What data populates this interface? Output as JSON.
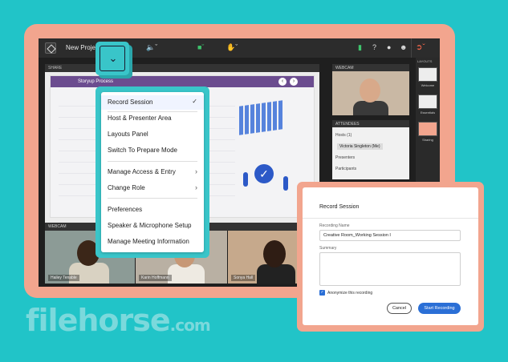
{
  "app": {
    "project_title": "New Project",
    "colors": {
      "accent": "#39c5c9",
      "frame": "#f2a58e",
      "primary_button": "#2b6fd6",
      "exit": "#f0664a"
    }
  },
  "topbar": {
    "icons": [
      "room-logo-icon",
      "speaker-icon",
      "video-camera-icon",
      "raise-hand-icon",
      "signal-icon",
      "help-icon",
      "bell-icon",
      "people-icon",
      "exit-icon"
    ]
  },
  "share_pod": {
    "header": "SHARE",
    "slide_title": "Storyup Process"
  },
  "webcam_bottom": {
    "header": "WEBCAM",
    "tiles": [
      {
        "name": "Hailey Tenable"
      },
      {
        "name": "Karin Hoffmann"
      },
      {
        "name": "Sonya Hall"
      }
    ]
  },
  "webcam_right": {
    "header": "WEBCAM"
  },
  "attendees": {
    "header": "ATTENDEES",
    "rows": [
      "Hosts (1)",
      "Victoria Singleton (Me)",
      "Presenters",
      "Participants"
    ]
  },
  "layouts": {
    "header": "LAYOUTS",
    "items": [
      "Welcome",
      "Essentials",
      "Sharing"
    ]
  },
  "menu": {
    "items": [
      {
        "label": "Record Session",
        "checked": true
      },
      {
        "label": "Host & Presenter Area"
      },
      {
        "label": "Layouts Panel"
      },
      {
        "label": "Switch To Prepare Mode"
      },
      {
        "label": "Manage Access & Entry",
        "submenu": true
      },
      {
        "label": "Change Role",
        "submenu": true
      },
      {
        "label": "Preferences"
      },
      {
        "label": "Speaker & Microphone Setup"
      },
      {
        "label": "Manage Meeting Information"
      }
    ]
  },
  "record_dialog": {
    "title": "Record Session",
    "name_label": "Recording Name",
    "name_value": "Creative Room_Working Session I",
    "summary_label": "Summary",
    "summary_value": "",
    "anonymize_label": "Anonymize this recording",
    "anonymize_checked": true,
    "cancel_label": "Cancel",
    "start_label": "Start Recording"
  },
  "watermark": {
    "brand": "filehorse",
    "tld": ".com"
  }
}
